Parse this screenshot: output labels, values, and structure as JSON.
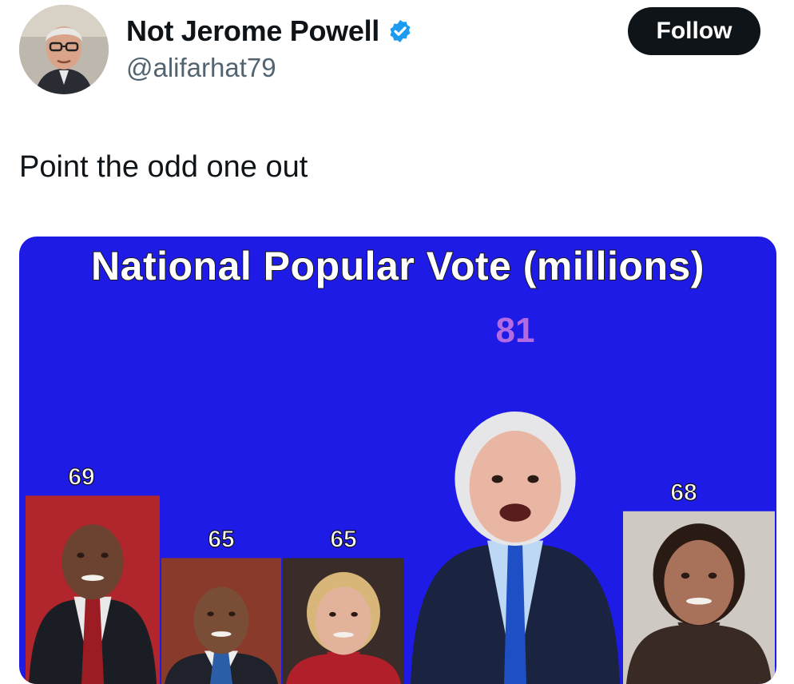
{
  "tweet": {
    "display_name": "Not Jerome Powell",
    "handle": "@alifarhat79",
    "follow_label": "Follow",
    "text": "Point the odd one out",
    "verified_icon": "verified-badge-icon",
    "verified_color": "#1d9bf0"
  },
  "chart_data": {
    "type": "bar",
    "title": "National Popular Vote (millions)",
    "categories": [
      "",
      "",
      "",
      "",
      ""
    ],
    "values": [
      69,
      65,
      65,
      81,
      68
    ],
    "label_color": "#ffffff",
    "highlight_label_color": "#b26be0",
    "background": "#1f1be6"
  }
}
